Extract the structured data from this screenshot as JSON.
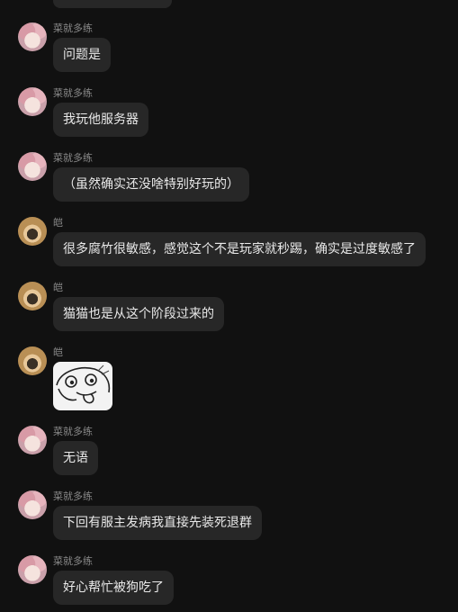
{
  "messages": [
    {
      "sender": "菜就多练",
      "avatar": "pink",
      "text": "问题是"
    },
    {
      "sender": "菜就多练",
      "avatar": "pink",
      "text": "我玩他服务器"
    },
    {
      "sender": "菜就多练",
      "avatar": "pink",
      "text": "（虽然确实还没啥特别好玩的）"
    },
    {
      "sender": "皑",
      "avatar": "blond",
      "text": "很多腐竹很敏感，感觉这个不是玩家就秒踢，确实是过度敏感了"
    },
    {
      "sender": "皑",
      "avatar": "blond",
      "text": "猫猫也是从这个阶段过来的"
    },
    {
      "sender": "皑",
      "avatar": "blond",
      "sticker": "meme-face-sticker"
    },
    {
      "sender": "菜就多练",
      "avatar": "pink",
      "text": "无语"
    },
    {
      "sender": "菜就多练",
      "avatar": "pink",
      "text": "下回有服主发病我直接先装死退群"
    },
    {
      "sender": "菜就多练",
      "avatar": "pink",
      "text": "好心帮忙被狗吃了"
    }
  ]
}
